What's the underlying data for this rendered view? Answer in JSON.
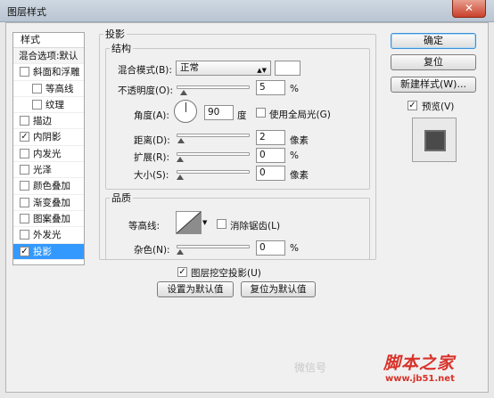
{
  "window": {
    "title": "图层样式",
    "close_icon": "close-icon"
  },
  "sidebar": {
    "header": "样式",
    "items": [
      {
        "label": "混合选项:默认",
        "checkbox": false,
        "checked": false,
        "sub": false,
        "selected": false
      },
      {
        "label": "斜面和浮雕",
        "checkbox": true,
        "checked": false,
        "sub": false,
        "selected": false
      },
      {
        "label": "等高线",
        "checkbox": true,
        "checked": false,
        "sub": true,
        "selected": false
      },
      {
        "label": "纹理",
        "checkbox": true,
        "checked": false,
        "sub": true,
        "selected": false
      },
      {
        "label": "描边",
        "checkbox": true,
        "checked": false,
        "sub": false,
        "selected": false
      },
      {
        "label": "内阴影",
        "checkbox": true,
        "checked": true,
        "sub": false,
        "selected": false
      },
      {
        "label": "内发光",
        "checkbox": true,
        "checked": false,
        "sub": false,
        "selected": false
      },
      {
        "label": "光泽",
        "checkbox": true,
        "checked": false,
        "sub": false,
        "selected": false
      },
      {
        "label": "颜色叠加",
        "checkbox": true,
        "checked": false,
        "sub": false,
        "selected": false
      },
      {
        "label": "渐变叠加",
        "checkbox": true,
        "checked": false,
        "sub": false,
        "selected": false
      },
      {
        "label": "图案叠加",
        "checkbox": true,
        "checked": false,
        "sub": false,
        "selected": false
      },
      {
        "label": "外发光",
        "checkbox": true,
        "checked": false,
        "sub": false,
        "selected": false
      },
      {
        "label": "投影",
        "checkbox": true,
        "checked": true,
        "sub": false,
        "selected": true
      }
    ]
  },
  "shadow": {
    "group_title": "投影",
    "structure_title": "结构",
    "blend_mode_label": "混合模式(B):",
    "blend_mode_value": "正常",
    "blend_color": "#ffffff",
    "opacity_label": "不透明度(O):",
    "opacity_value": "5",
    "opacity_unit": "%",
    "angle_label": "角度(A):",
    "angle_value": "90",
    "angle_unit": "度",
    "global_light_label": "使用全局光(G)",
    "global_light_checked": false,
    "distance_label": "距离(D):",
    "distance_value": "2",
    "distance_unit": "像素",
    "spread_label": "扩展(R):",
    "spread_value": "0",
    "spread_unit": "%",
    "size_label": "大小(S):",
    "size_value": "0",
    "size_unit": "像素",
    "quality_title": "品质",
    "contour_label": "等高线:",
    "antialias_label": "消除锯齿(L)",
    "antialias_checked": false,
    "noise_label": "杂色(N):",
    "noise_value": "0",
    "noise_unit": "%",
    "knockout_label": "图层挖空投影(U)",
    "knockout_checked": true,
    "set_default_label": "设置为默认值",
    "reset_default_label": "复位为默认值"
  },
  "buttons": {
    "ok": "确定",
    "reset": "复位",
    "new_style": "新建样式(W)...",
    "preview_label": "预览(V)",
    "preview_checked": true
  },
  "watermark": {
    "wechat": "微信号",
    "site_name": "脚本之家",
    "site_url": "www.jb51.net"
  }
}
